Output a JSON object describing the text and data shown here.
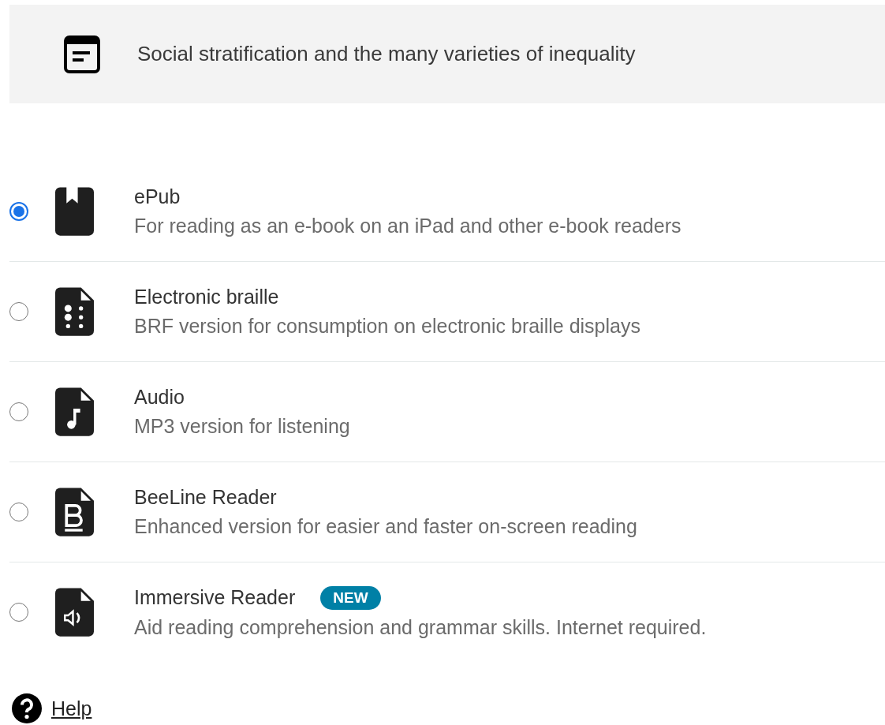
{
  "header": {
    "title": "Social stratification and the many varieties of inequality"
  },
  "formats": [
    {
      "kind": "epub",
      "title": "ePub",
      "description": "For reading as an e-book on an iPad and other e-book readers",
      "selected": true
    },
    {
      "kind": "braille",
      "title": "Electronic braille",
      "description": "BRF version for consumption on electronic braille displays",
      "selected": false
    },
    {
      "kind": "audio",
      "title": "Audio",
      "description": "MP3 version for listening",
      "selected": false
    },
    {
      "kind": "beeline",
      "title": "BeeLine Reader",
      "description": "Enhanced version for easier and faster on-screen reading",
      "selected": false
    },
    {
      "kind": "immersive",
      "title": "Immersive Reader",
      "badge": "NEW",
      "description": "Aid reading comprehension and grammar skills. Internet required.",
      "selected": false
    }
  ],
  "help": {
    "label": "Help"
  }
}
